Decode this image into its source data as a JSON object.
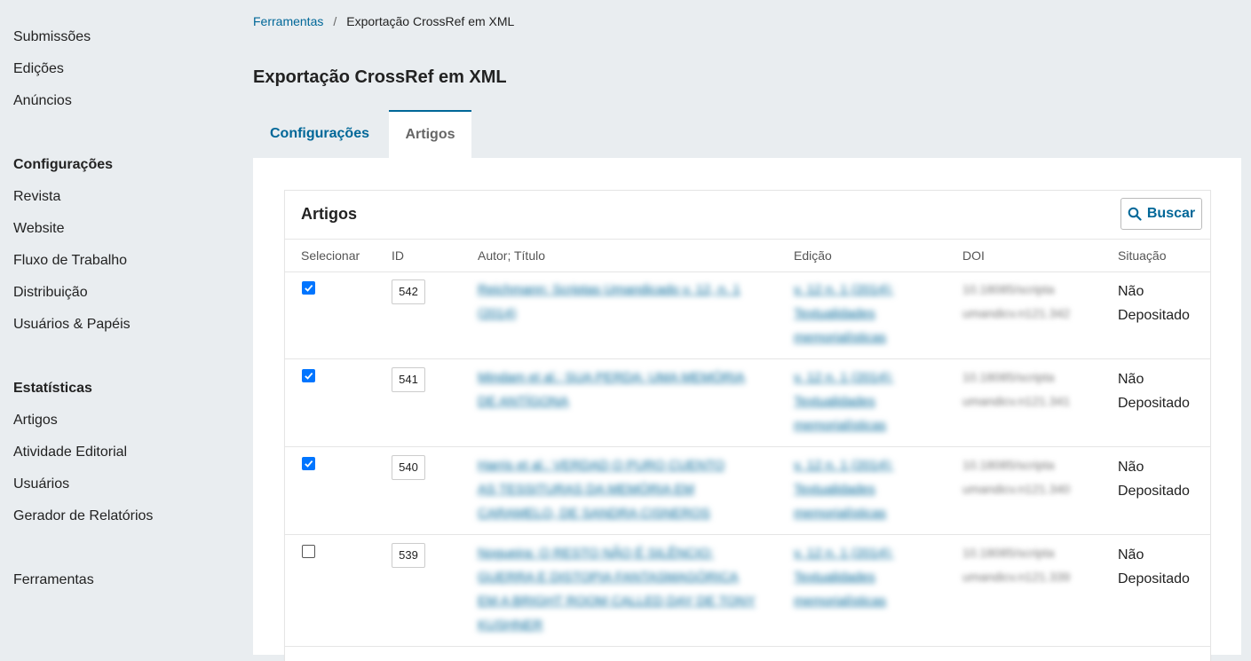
{
  "sidebar": {
    "items_top": [
      "Submissões",
      "Edições",
      "Anúncios"
    ],
    "section_config": "Configurações",
    "items_config": [
      "Revista",
      "Website",
      "Fluxo de Trabalho",
      "Distribuição",
      "Usuários & Papéis"
    ],
    "section_stats": "Estatísticas",
    "items_stats": [
      "Artigos",
      "Atividade Editorial",
      "Usuários",
      "Gerador de Relatórios"
    ],
    "tools": "Ferramentas"
  },
  "breadcrumb": {
    "link": "Ferramentas",
    "separator": "/",
    "current": "Exportação CrossRef em XML"
  },
  "page_title": "Exportação CrossRef em XML",
  "tabs": [
    "Configurações",
    "Artigos"
  ],
  "listing": {
    "title": "Artigos",
    "search_label": "Buscar",
    "columns": [
      "Selecionar",
      "ID",
      "Autor; Título",
      "Edição",
      "DOI",
      "Situação"
    ],
    "rows": [
      {
        "checked": true,
        "id": "542",
        "title_lines": [
          "Reichmann: Scriptas Umandicado v. 12, n. 1",
          "(2014)"
        ],
        "issue_lines": [
          "v. 12 n. 1 (2014):",
          "Textualidades",
          "memorialísticas"
        ],
        "doi_lines": [
          "10.18085/scripta",
          "umandicv.n121.342"
        ],
        "status_lines": [
          "Não",
          "Depositado"
        ]
      },
      {
        "checked": true,
        "id": "541",
        "title_lines": [
          "Mindam et al.: SUA PERDA: UMA MEMÓRIA",
          "DE ANTÍGONA"
        ],
        "issue_lines": [
          "v. 12 n. 1 (2014):",
          "Textualidades",
          "memorialísticas"
        ],
        "doi_lines": [
          "10.18085/scripta",
          "umandicv.n121.341"
        ],
        "status_lines": [
          "Não",
          "Depositado"
        ]
      },
      {
        "checked": true,
        "id": "540",
        "title_lines": [
          "Harris et al.: VERDAD O PURO CUENTO",
          "AS TESSITURAS DA MEMÓRIA EM",
          "CARAMELO, DE SANDRA CISNEROS"
        ],
        "issue_lines": [
          "v. 12 n. 1 (2014):",
          "Textualidades",
          "memorialísticas"
        ],
        "doi_lines": [
          "10.18085/scripta",
          "umandicv.n121.340"
        ],
        "status_lines": [
          "Não",
          "Depositado"
        ]
      },
      {
        "checked": false,
        "id": "539",
        "title_lines": [
          "Nogueira: O RESTO NÃO É SILÊNCIO:",
          "GUERRA E DISTOPIA FANTASMAGÓRICA",
          "EM A BRIGHT ROOM CALLED DAY DE TONY",
          "KUSHNER"
        ],
        "issue_lines": [
          "v. 12 n. 1 (2014):",
          "Textualidades",
          "memorialísticas"
        ],
        "doi_lines": [
          "10.18085/scripta",
          "umandicv.n121.339"
        ],
        "status_lines": [
          "Não",
          "Depositado"
        ]
      }
    ]
  }
}
